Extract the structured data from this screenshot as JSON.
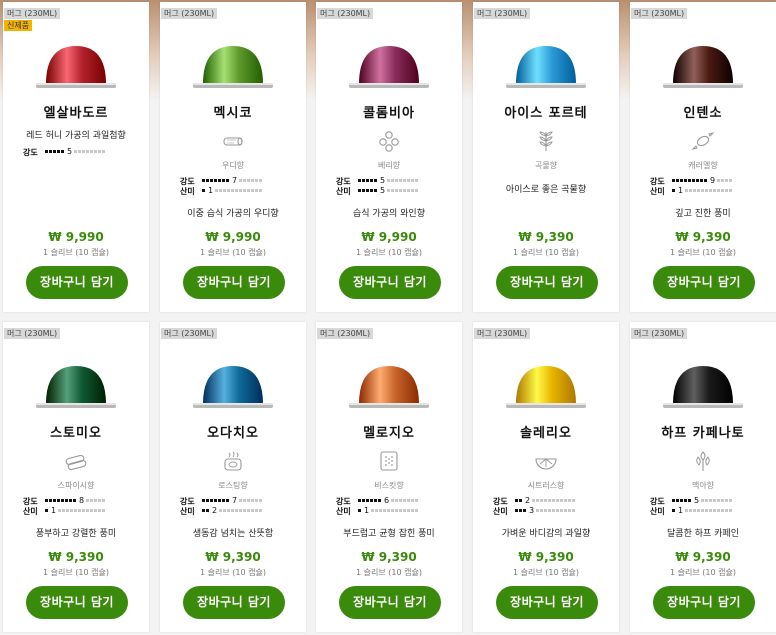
{
  "products": [
    {
      "size_tag": "머그 (230ML)",
      "new_tag": "신제품",
      "name": "엘살바도르",
      "aroma_icon": "none",
      "aroma": "",
      "intensity": 5,
      "intensity_label": "강도",
      "acidity": null,
      "acidity_label": "",
      "description": "레드 허니 가공의 과일첨향",
      "price": "₩ 9,990",
      "unit": "1 슬리브 (10 캡슐)",
      "cart_label": "장바구니 담기",
      "capsule_color": "#b3222c",
      "capsule_text": "El Sal"
    },
    {
      "size_tag": "머그 (230ML)",
      "new_tag": "",
      "name": "멕시코",
      "aroma_icon": "wood-icon",
      "aroma": "우디향",
      "intensity": 7,
      "intensity_label": "강도",
      "acidity": 1,
      "acidity_label": "산미",
      "description": "이중 습식 가공의 우디향",
      "price": "₩ 9,990",
      "unit": "1 슬리브 (10 캡슐)",
      "cart_label": "장바구니 담기",
      "capsule_color": "#5e9a2c",
      "capsule_text": "Mexico"
    },
    {
      "size_tag": "머그 (230ML)",
      "new_tag": "",
      "name": "콜롬비아",
      "aroma_icon": "berry-icon",
      "aroma": "베리향",
      "intensity": 5,
      "intensity_label": "강도",
      "acidity": 5,
      "acidity_label": "산미",
      "description": "습식 가공의 와인향",
      "price": "₩ 9,990",
      "unit": "1 슬리브 (10 캡슐)",
      "cart_label": "장바구니 담기",
      "capsule_color": "#8a2c5b",
      "capsule_text": "Colombia"
    },
    {
      "size_tag": "머그 (230ML)",
      "new_tag": "",
      "name": "아이스 포르테",
      "aroma_icon": "grain-icon",
      "aroma": "곡물향",
      "intensity": null,
      "intensity_label": "",
      "acidity": null,
      "acidity_label": "",
      "description": "아이스로 좋은 곡물향",
      "price": "₩ 9,390",
      "unit": "1 슬리브 (10 캡슐)",
      "cart_label": "장바구니 담기",
      "capsule_color": "#2a9ad6",
      "capsule_text": ""
    },
    {
      "size_tag": "머그 (230ML)",
      "new_tag": "",
      "name": "인텐소",
      "aroma_icon": "candy-icon",
      "aroma": "캐러멜향",
      "intensity": 9,
      "intensity_label": "강도",
      "acidity": 1,
      "acidity_label": "산미",
      "description": "깊고 진한 풍미",
      "price": "₩ 9,390",
      "unit": "1 슬리브 (10 캡슐)",
      "cart_label": "장바구니 담기",
      "capsule_color": "#4a1a12",
      "capsule_text": ""
    },
    {
      "size_tag": "머그 (230ML)",
      "new_tag": "",
      "name": "스토미오",
      "aroma_icon": "spice-icon",
      "aroma": "스파이시향",
      "intensity": 8,
      "intensity_label": "강도",
      "acidity": 1,
      "acidity_label": "산미",
      "description": "풍부하고 강렬한 풍미",
      "price": "₩ 9,390",
      "unit": "1 슬리브 (10 캡슐)",
      "cart_label": "장바구니 담기",
      "capsule_color": "#0f5a34",
      "capsule_text": ""
    },
    {
      "size_tag": "머그 (230ML)",
      "new_tag": "",
      "name": "오다치오",
      "aroma_icon": "roast-icon",
      "aroma": "로스팅향",
      "intensity": 7,
      "intensity_label": "강도",
      "acidity": 2,
      "acidity_label": "산미",
      "description": "생동감 넘치는 산뜻함",
      "price": "₩ 9,390",
      "unit": "1 슬리브 (10 캡슐)",
      "cart_label": "장바구니 담기",
      "capsule_color": "#0f6a98",
      "capsule_text": ""
    },
    {
      "size_tag": "머그 (230ML)",
      "new_tag": "",
      "name": "멜로지오",
      "aroma_icon": "biscuit-icon",
      "aroma": "비스킷향",
      "intensity": 6,
      "intensity_label": "강도",
      "acidity": 1,
      "acidity_label": "산미",
      "description": "부드럽고 균형 잡힌 풍미",
      "price": "₩ 9,390",
      "unit": "1 슬리브 (10 캡슐)",
      "cart_label": "장바구니 담기",
      "capsule_color": "#c8652c",
      "capsule_text": ""
    },
    {
      "size_tag": "머그 (230ML)",
      "new_tag": "",
      "name": "솔레리오",
      "aroma_icon": "citrus-icon",
      "aroma": "시트러스향",
      "intensity": 2,
      "intensity_label": "강도",
      "acidity": 3,
      "acidity_label": "산미",
      "description": "가벼운 바디감의 과일향",
      "price": "₩ 9,390",
      "unit": "1 슬리브 (10 캡슐)",
      "cart_label": "장바구니 담기",
      "capsule_color": "#e8b400",
      "capsule_text": ""
    },
    {
      "size_tag": "머그 (230ML)",
      "new_tag": "",
      "name": "하프 카페나토",
      "aroma_icon": "malt-icon",
      "aroma": "맥아향",
      "intensity": 5,
      "intensity_label": "강도",
      "acidity": 1,
      "acidity_label": "산미",
      "description": "달콤한 하프 카페인",
      "price": "₩ 9,390",
      "unit": "1 슬리브 (10 캡슐)",
      "cart_label": "장바구니 담기",
      "capsule_color": "#1a1a1a",
      "capsule_text": ""
    }
  ]
}
